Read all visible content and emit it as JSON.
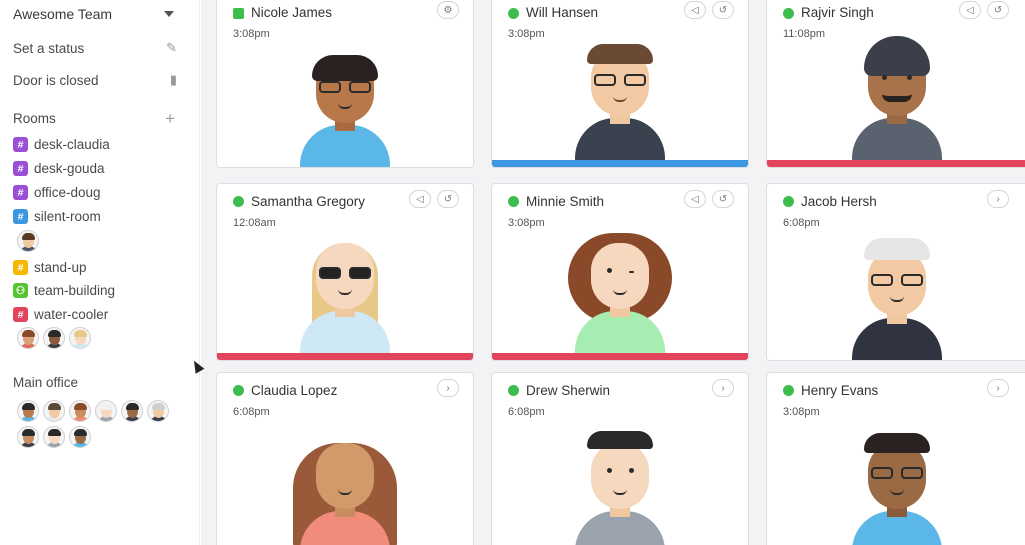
{
  "sidebar": {
    "team_name": "Awesome Team",
    "set_status": "Set a status",
    "door_status": "Door is closed",
    "rooms_title": "Rooms",
    "rooms": [
      {
        "label": "desk-claudia",
        "color": "#9b4fd6"
      },
      {
        "label": "desk-gouda",
        "color": "#9b4fd6"
      },
      {
        "label": "office-doug",
        "color": "#9b4fd6"
      },
      {
        "label": "silent-room",
        "color": "#3b97e0"
      },
      {
        "label": "stand-up",
        "color": "#f5b800"
      },
      {
        "label": "team-building",
        "color": "#55c431"
      },
      {
        "label": "water-cooler",
        "color": "#e2445c"
      }
    ],
    "main_office_title": "Main office"
  },
  "cards": [
    {
      "name": "Nicole James",
      "time": "3:08pm",
      "actions": [
        "gear-icon"
      ],
      "bar": ""
    },
    {
      "name": "Will Hansen",
      "time": "3:08pm",
      "actions": [
        "megaphone-icon",
        "history-icon"
      ],
      "bar": "#3b97e0"
    },
    {
      "name": "Rajvir Singh",
      "time": "11:08pm",
      "actions": [
        "megaphone-icon",
        "history-icon"
      ],
      "bar": "#e2445c"
    },
    {
      "name": "Samantha Gregory",
      "time": "12:08am",
      "actions": [
        "megaphone-icon",
        "history-icon"
      ],
      "bar": "#e2445c"
    },
    {
      "name": "Minnie Smith",
      "time": "3:08pm",
      "actions": [
        "megaphone-icon",
        "history-icon"
      ],
      "bar": "#e2445c"
    },
    {
      "name": "Jacob Hersh",
      "time": "6:08pm",
      "actions": [
        "chevron-right-icon"
      ],
      "bar": ""
    },
    {
      "name": "Claudia Lopez",
      "time": "6:08pm",
      "actions": [
        "chevron-right-icon"
      ],
      "bar": ""
    },
    {
      "name": "Drew Sherwin",
      "time": "6:08pm",
      "actions": [
        "chevron-right-icon"
      ],
      "bar": ""
    },
    {
      "name": "Henry Evans",
      "time": "3:08pm",
      "actions": [
        "chevron-right-icon"
      ],
      "bar": ""
    }
  ],
  "colors": {
    "online": "#3dbd4e",
    "blue_bar": "#3b97e0",
    "red_bar": "#e2445c"
  }
}
